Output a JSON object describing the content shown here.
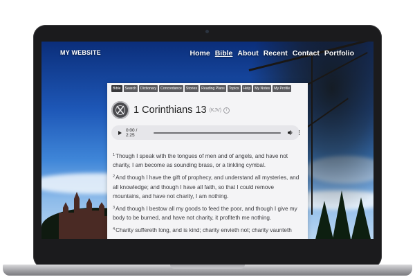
{
  "site": {
    "brand": "MY WEBSITE",
    "nav": [
      {
        "label": "Home",
        "active": false
      },
      {
        "label": "Bible",
        "active": true
      },
      {
        "label": "About",
        "active": false
      },
      {
        "label": "Recent",
        "active": false
      },
      {
        "label": "Contact",
        "active": false
      },
      {
        "label": "Portfolio",
        "active": false
      }
    ]
  },
  "bible": {
    "tabs": [
      "Bible",
      "Search",
      "Dictionary",
      "Concordance",
      "Stories",
      "Reading Plans",
      "Topics",
      "Help",
      "My Notes",
      "My Profile"
    ],
    "active_tab": "Bible",
    "chapter_title": "1 Corinthians 13",
    "version": "(KJV)",
    "audio": {
      "time": "0:00 / 2:25",
      "progress": 0
    },
    "verses": [
      {
        "num": "1",
        "text": "Though I speak with the tongues of men and of angels, and have not charity, I am become as sounding brass, or a tinkling cymbal."
      },
      {
        "num": "2",
        "text": "And though I have the gift of prophecy, and understand all mysteries, and all knowledge; and though I have all faith, so that I could remove mountains, and have not charity, I am nothing."
      },
      {
        "num": "3",
        "text": "And though I bestow all my goods to feed the poor, and though I give my body to be burned, and have not charity, it profiteth me nothing."
      },
      {
        "num": "4",
        "text": "Charity suffereth long, and is kind; charity envieth not; charity vaunteth"
      }
    ]
  },
  "icons": {
    "logo": "bible-logo-icon",
    "info": "info-icon",
    "play": "play-icon",
    "volume": "volume-icon",
    "more": "more-options-icon"
  }
}
